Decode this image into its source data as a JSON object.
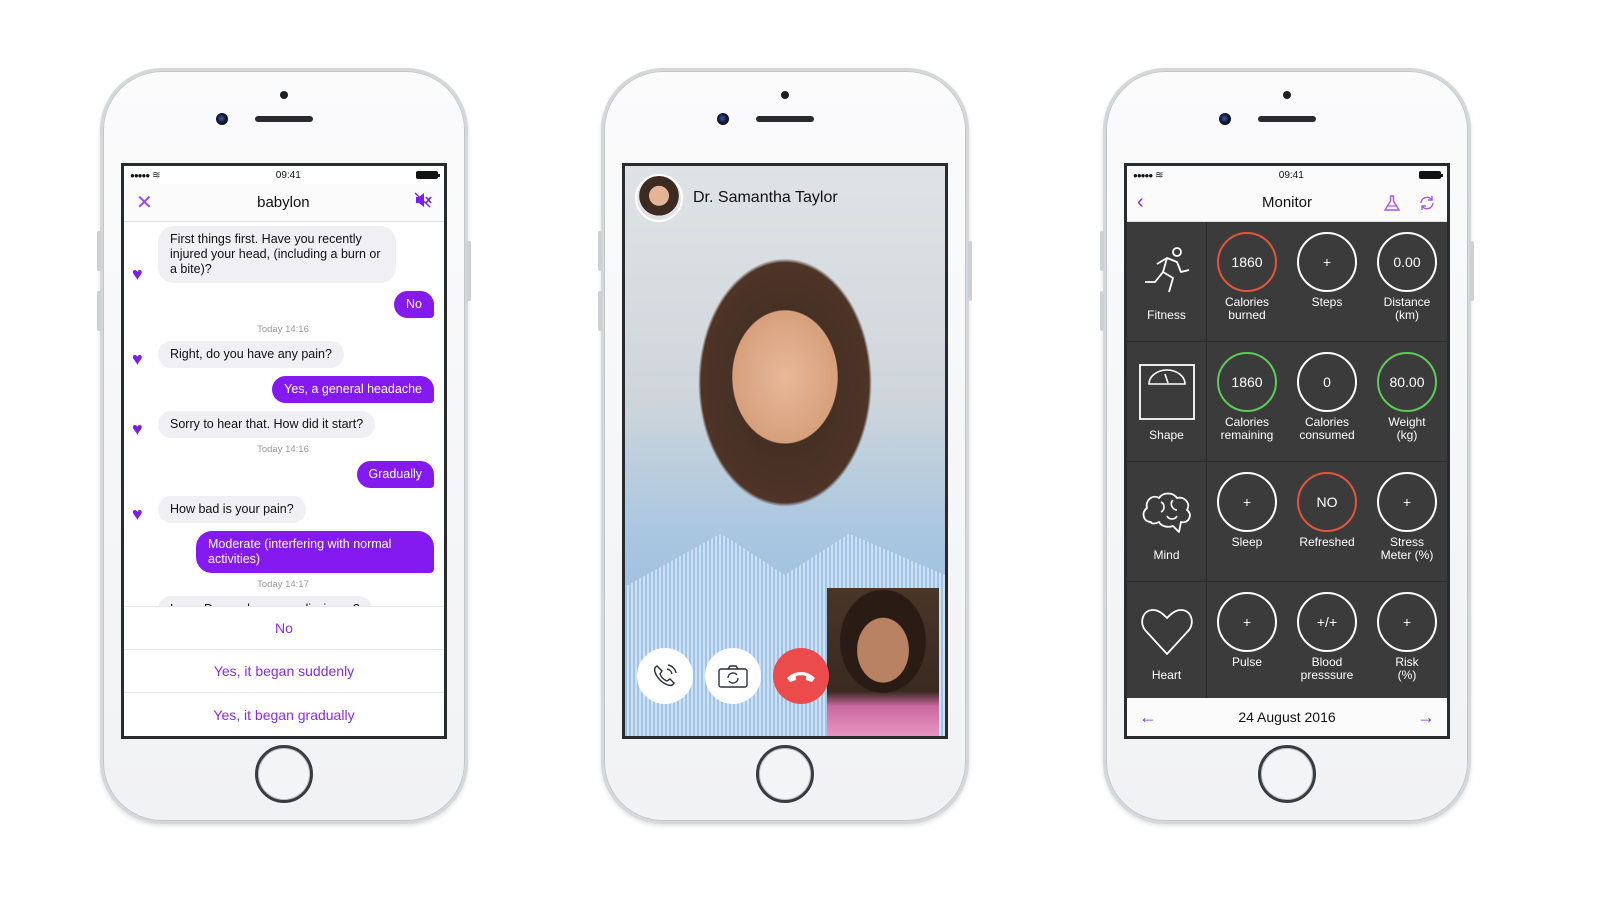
{
  "colors": {
    "accent_purple": "#8419f0",
    "bubble_bot": "#efeff4",
    "end_call_red": "#ec4b4b",
    "ring_orange": "#e2563c",
    "ring_green": "#5dcb5a",
    "monitor_bg": "#3b3b3b"
  },
  "status_bar": {
    "time": "09:41",
    "signal_icon": "signal-dots-icon",
    "wifi_icon": "wifi-icon",
    "battery_icon": "battery-icon"
  },
  "chat": {
    "title": "babylon",
    "close_icon": "close-icon",
    "mute_icon": "speaker-muted-icon",
    "messages": [
      {
        "from": "bot",
        "text": "First things first. Have you recently injured your head, (including a burn or a bite)?"
      },
      {
        "from": "user",
        "text": "No"
      },
      {
        "timestamp": "Today 14:16"
      },
      {
        "from": "bot",
        "text": "Right, do you have any pain?"
      },
      {
        "from": "user",
        "text": "Yes, a general headache"
      },
      {
        "from": "bot",
        "text": "Sorry to hear that. How did it start?"
      },
      {
        "timestamp": "Today 14:16"
      },
      {
        "from": "user",
        "text": "Gradually"
      },
      {
        "from": "bot",
        "text": "How bad is your pain?"
      },
      {
        "from": "user",
        "text": "Moderate (interfering with normal activities)"
      },
      {
        "timestamp": "Today 14:17"
      },
      {
        "from": "bot",
        "text": "I see. Do you have any dizziness?"
      }
    ],
    "options": [
      "No",
      "Yes, it began suddenly",
      "Yes, it began gradually"
    ]
  },
  "video_call": {
    "doctor_name": "Dr. Samantha Taylor",
    "controls": [
      {
        "name": "speaker-call-button",
        "icon": "phone-speaker-icon"
      },
      {
        "name": "switch-camera-button",
        "icon": "camera-rotate-icon"
      },
      {
        "name": "end-call-button",
        "icon": "hang-up-icon"
      }
    ]
  },
  "monitor": {
    "title": "Monitor",
    "back_icon": "chevron-left-icon",
    "lab_icon": "flask-icon",
    "sync_icon": "refresh-icon",
    "rows": [
      {
        "category": "Fitness",
        "icon": "running-person-icon",
        "metrics": [
          {
            "value": "1860",
            "label": "Calories burned",
            "ring": "orange"
          },
          {
            "value": "+",
            "label": "Steps",
            "ring": "white"
          },
          {
            "value": "0.00",
            "label": "Distance (km)",
            "ring": "white"
          }
        ]
      },
      {
        "category": "Shape",
        "icon": "scale-icon",
        "metrics": [
          {
            "value": "1860",
            "label": "Calories remaining",
            "ring": "green"
          },
          {
            "value": "0",
            "label": "Calories consumed",
            "ring": "white"
          },
          {
            "value": "80.00",
            "label": "Weight (kg)",
            "ring": "green"
          }
        ]
      },
      {
        "category": "Mind",
        "icon": "brain-icon",
        "metrics": [
          {
            "value": "+",
            "label": "Sleep",
            "ring": "white"
          },
          {
            "value": "NO",
            "label": "Refreshed",
            "ring": "orange"
          },
          {
            "value": "+",
            "label": "Stress Meter (%)",
            "ring": "white"
          }
        ]
      },
      {
        "category": "Heart",
        "icon": "heart-outline-icon",
        "metrics": [
          {
            "value": "+",
            "label": "Pulse",
            "ring": "white"
          },
          {
            "value": "+/+",
            "label": "Blood presssure",
            "ring": "white"
          },
          {
            "value": "+",
            "label": "Risk (%)",
            "ring": "white"
          }
        ]
      }
    ],
    "date": "24 August 2016"
  }
}
